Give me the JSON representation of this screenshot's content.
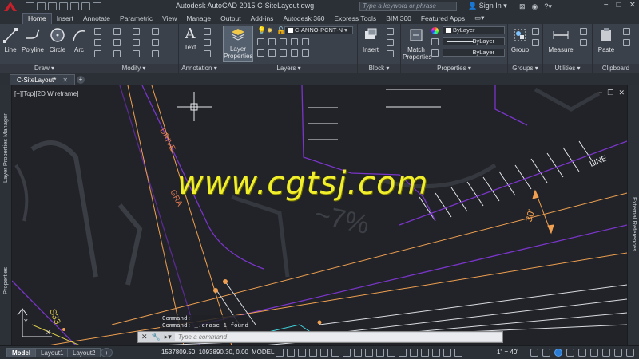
{
  "window": {
    "title": "Autodesk AutoCAD 2015    C-SiteLayout.dwg",
    "search_placeholder": "Type a keyword or phrase",
    "signin": "Sign In"
  },
  "ribbon_tabs": [
    "Home",
    "Insert",
    "Annotate",
    "Parametric",
    "View",
    "Manage",
    "Output",
    "Add-ins",
    "Autodesk 360",
    "Express Tools",
    "BIM 360",
    "Featured Apps"
  ],
  "ribbon_active_tab": "Home",
  "panels": {
    "draw": {
      "title": "Draw ▾",
      "tools": [
        "Line",
        "Polyline",
        "Circle",
        "Arc"
      ]
    },
    "modify": {
      "title": "Modify ▾"
    },
    "annotation": {
      "title": "Annotation ▾",
      "tools": [
        "Text"
      ]
    },
    "layers": {
      "title": "Layers ▾",
      "layer_properties": "Layer Properties",
      "current_layer": "C-ANNO-PCNT-N"
    },
    "block": {
      "title": "Block ▾",
      "tools": [
        "Insert"
      ]
    },
    "properties": {
      "title": "Properties ▾",
      "match": "Match Properties",
      "bylayer1": "ByLayer",
      "bylayer2": "ByLayer",
      "bylayer3": "ByLayer"
    },
    "groups": {
      "title": "Groups ▾",
      "tools": [
        "Group"
      ]
    },
    "utilities": {
      "title": "Utilities ▾",
      "tools": [
        "Measure"
      ]
    },
    "clipboard": {
      "title": "Clipboard",
      "tools": [
        "Paste"
      ]
    }
  },
  "doc_tab": "C-SiteLayout*",
  "left_palette": [
    "Layer Properties Manager",
    "Properties"
  ],
  "right_palette": [
    "External References"
  ],
  "viewport_label": "[−][Top][2D Wireframe]",
  "watermark": "www.cgtsj.com",
  "drawing_text": {
    "drive": "DRIVE",
    "gra": "GRA",
    "line": "LINE",
    "dim": "30'",
    "s33": "S33",
    "pct": "~7%"
  },
  "command": {
    "history1": "Command:",
    "history2": "Command: _.erase 1 found",
    "placeholder": "Type a command"
  },
  "layout_tabs": [
    "Model",
    "Layout1",
    "Layout2"
  ],
  "status": {
    "coords": "1537809.50, 1093890.30, 0.00",
    "space": "MODEL",
    "scale": "1\" = 40'"
  },
  "colors": {
    "accent_red": "#c8202a",
    "ribbon": "#3b414a",
    "canvas": "#212328",
    "watermark": "#f1ee2c",
    "purple_line": "#7a35c9",
    "orange_line": "#f0a050"
  }
}
